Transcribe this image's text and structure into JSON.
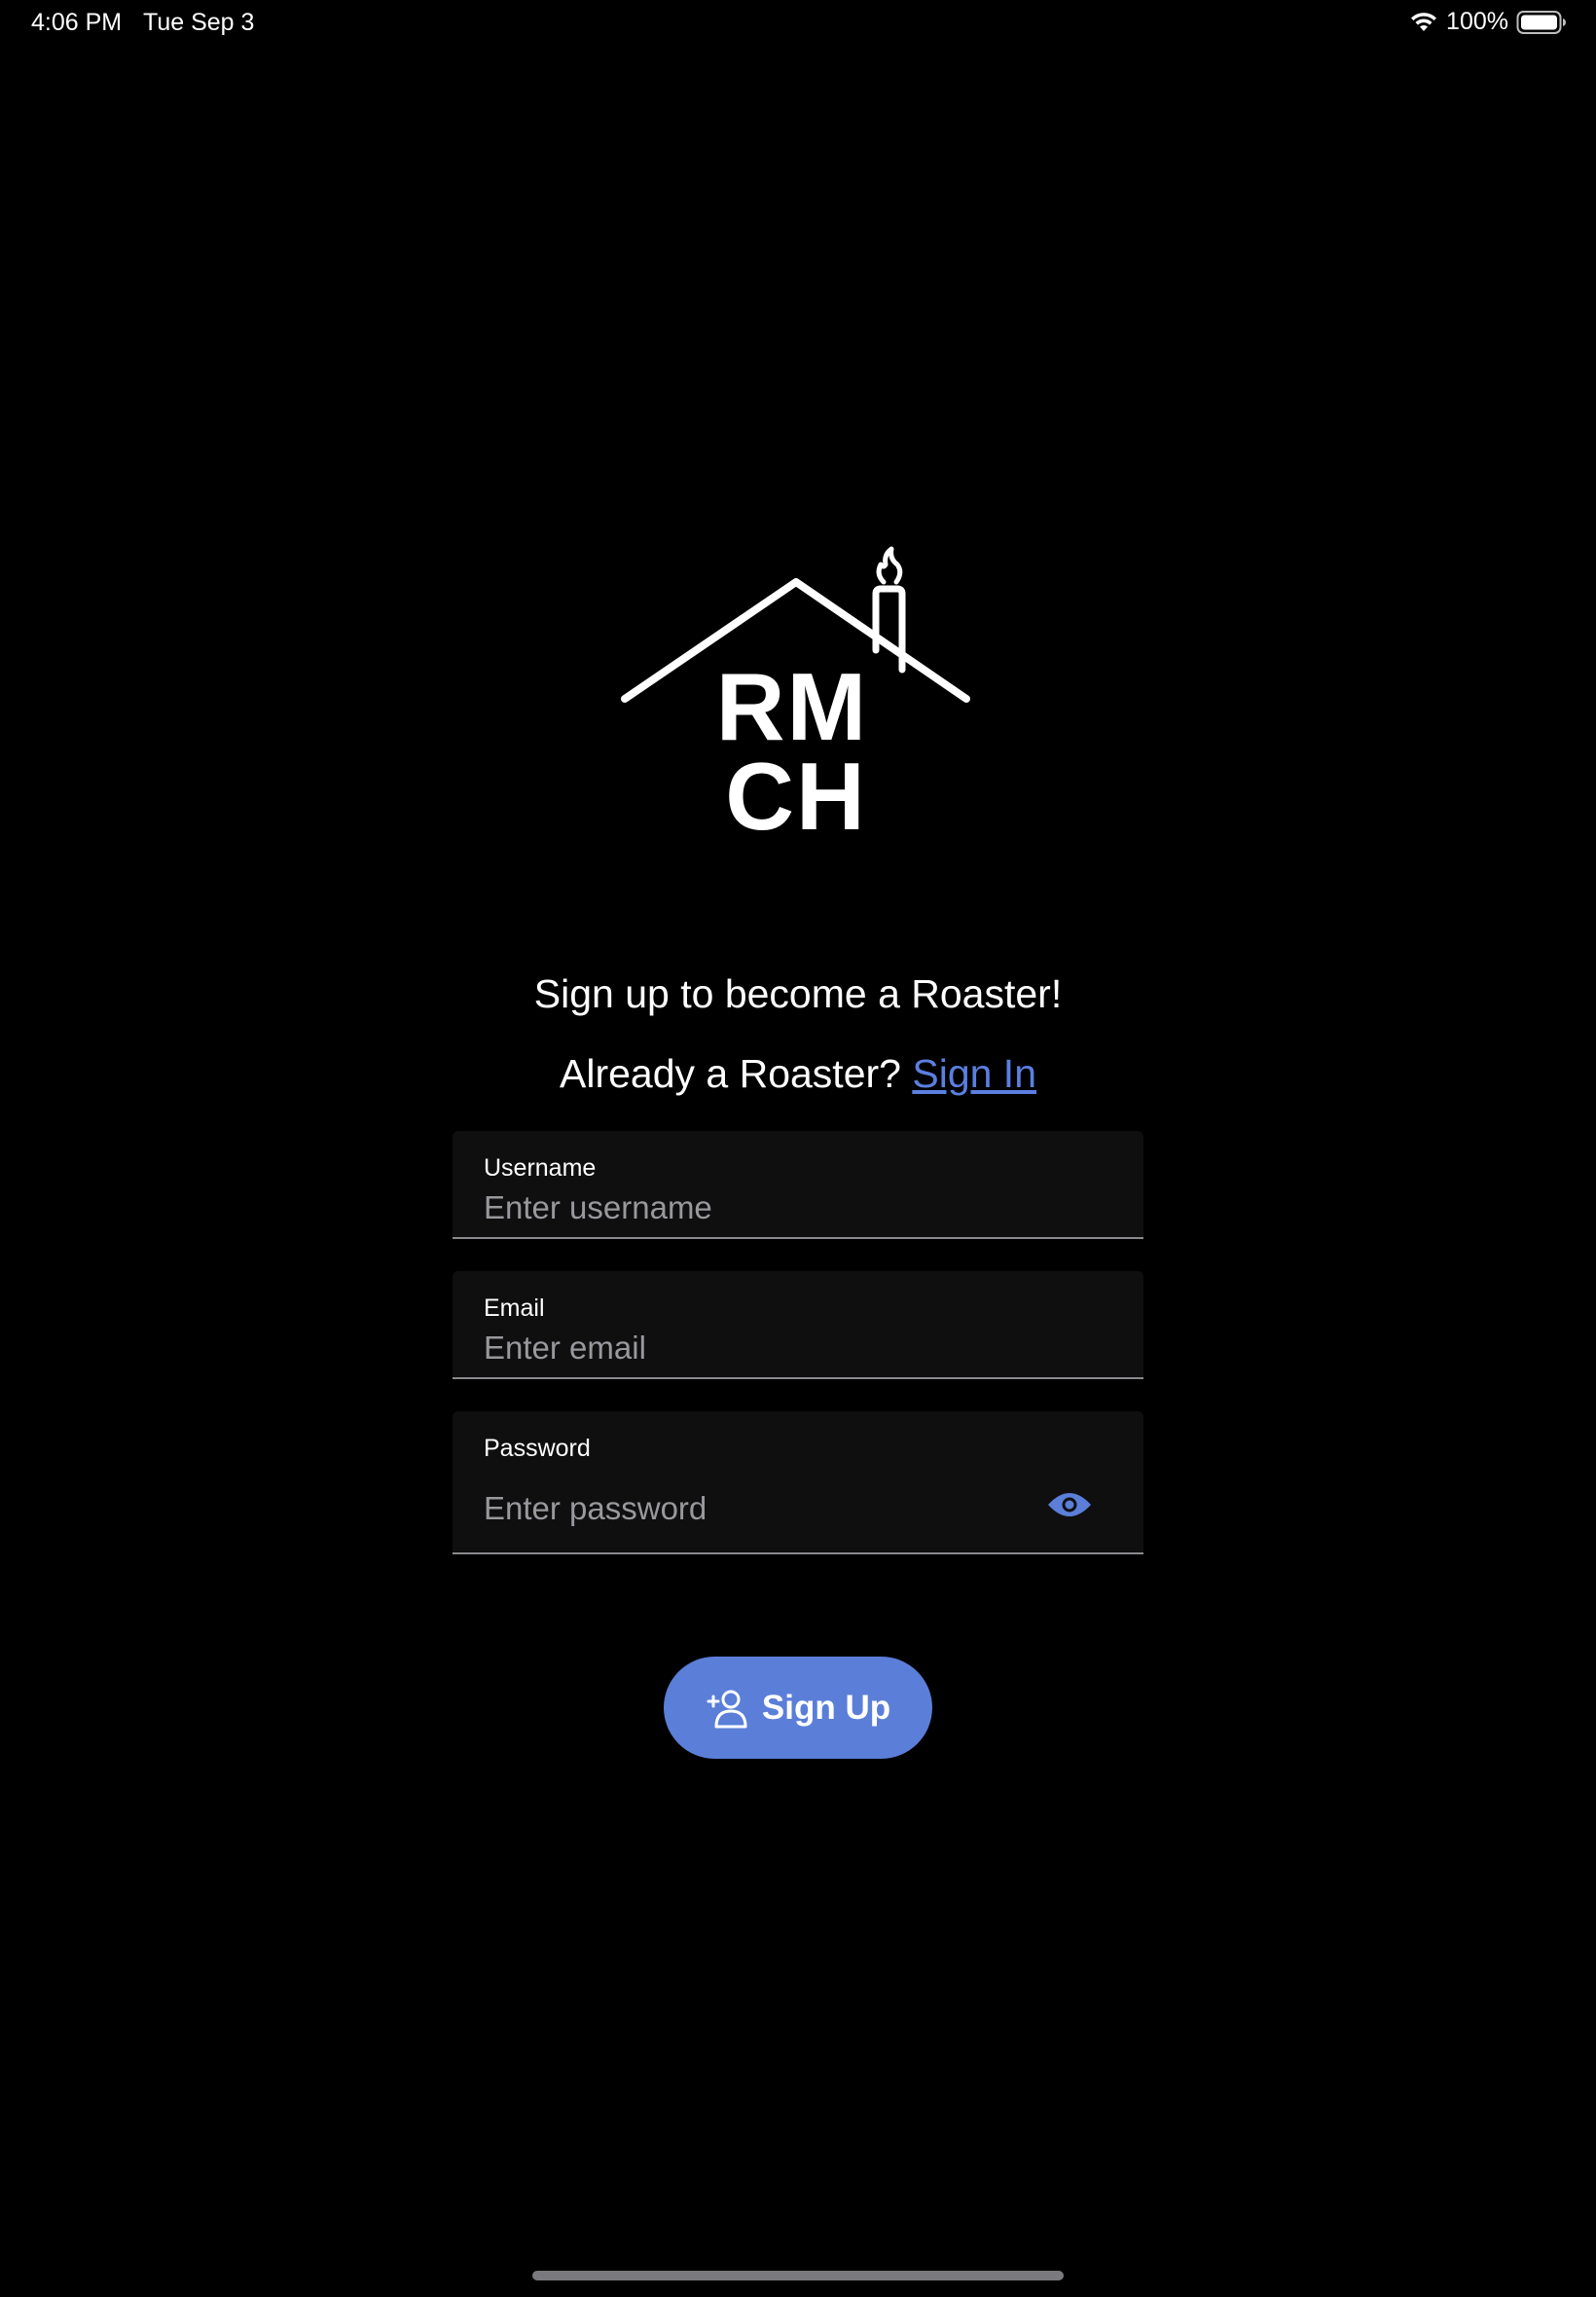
{
  "status_bar": {
    "time": "4:06 PM",
    "date": "Tue Sep 3",
    "battery_percent": "100%",
    "wifi_icon": "wifi-icon",
    "battery_icon": "battery-full-icon"
  },
  "logo": {
    "line1": "RM",
    "line2": "CH",
    "icon": "house-with-chimney-flame-logo"
  },
  "header": {
    "title": "Sign up to become a Roaster!",
    "already_prefix": "Already a Roaster?",
    "sign_in_link": "Sign In"
  },
  "form": {
    "username": {
      "label": "Username",
      "placeholder": "Enter username",
      "value": ""
    },
    "email": {
      "label": "Email",
      "placeholder": "Enter email",
      "value": ""
    },
    "password": {
      "label": "Password",
      "placeholder": "Enter password",
      "value": "",
      "toggle_icon": "eye-icon"
    }
  },
  "actions": {
    "signup_label": "Sign Up",
    "signup_icon": "add-user-icon"
  },
  "colors": {
    "background": "#000000",
    "accent": "#5b7fd8",
    "link": "#5b7fe0",
    "field_bg": "#0f0f10",
    "placeholder": "#98989d"
  }
}
